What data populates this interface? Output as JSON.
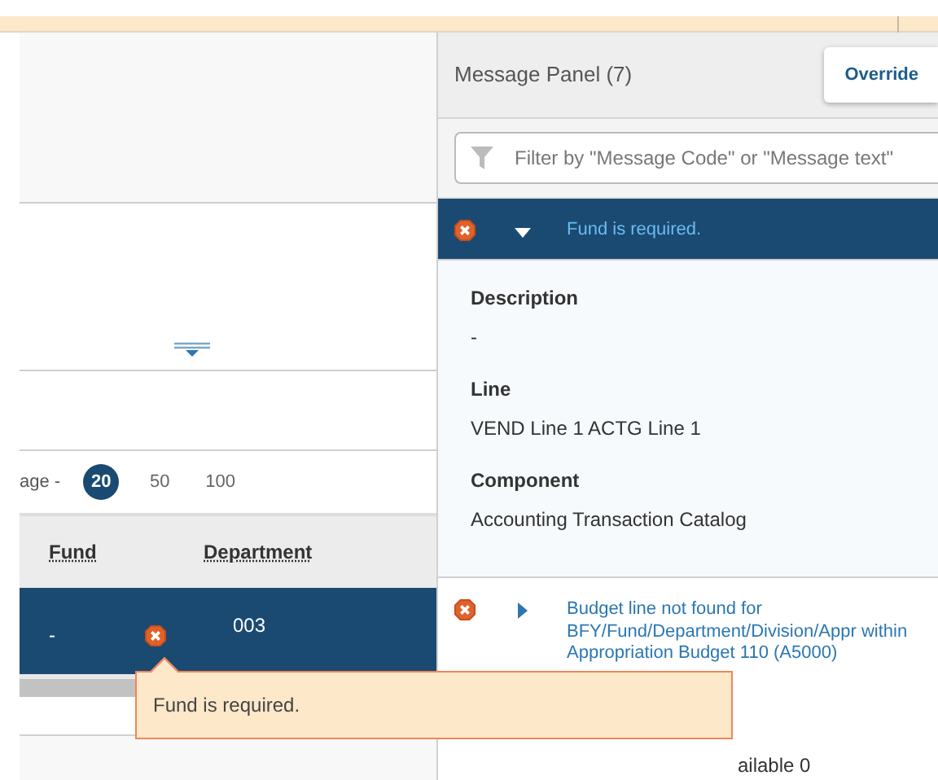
{
  "grid": {
    "pagination": {
      "label": "age -",
      "options": [
        {
          "label": "20",
          "selected": true
        },
        {
          "label": "50",
          "selected": false
        },
        {
          "label": "100",
          "selected": false
        }
      ]
    },
    "columns": [
      "Fund",
      "Department"
    ],
    "rows": [
      {
        "selected": true,
        "fund": "-",
        "fund_error": true,
        "department": "003"
      }
    ],
    "tooltip": "Fund is required."
  },
  "message_panel": {
    "title": "Message Panel (7)",
    "override_button": "Override",
    "filter": {
      "placeholder": "Filter by \"Message Code\" or \"Message text\""
    },
    "messages": [
      {
        "text": "Fund is required.",
        "selected": true,
        "expanded": true,
        "details": [
          {
            "label": "Description",
            "value": "-"
          },
          {
            "label": "Line",
            "value": "VEND Line 1 ACTG Line 1"
          },
          {
            "label": "Component",
            "value": "Accounting Transaction Catalog"
          }
        ]
      },
      {
        "text": "Budget line not found for BFY/Fund/Department/Division/Appr within Appropriation Budget 110 (A5000)",
        "selected": false,
        "expanded": false,
        "summary": "ailable 0"
      }
    ]
  }
}
